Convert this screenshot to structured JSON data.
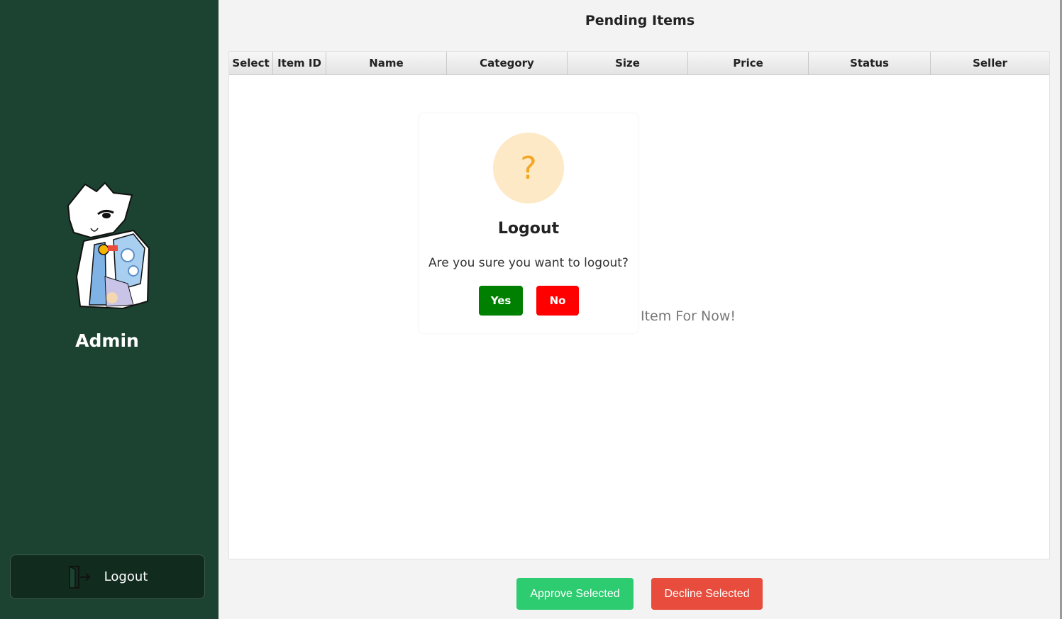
{
  "sidebar": {
    "user_name": "Admin",
    "logout_label": "Logout",
    "logout_icon": "door-exit-icon",
    "background": "#1c4331"
  },
  "main": {
    "title": "Pending Items",
    "columns": [
      "Select",
      "Item ID",
      "Name",
      "Category",
      "Size",
      "Price",
      "Status",
      "Seller"
    ],
    "empty_message_partial": "Item For Now!",
    "approve_label": "Approve Selected",
    "decline_label": "Decline Selected",
    "approve_color": "#2ecc71",
    "decline_color": "#e74c3c"
  },
  "dialog": {
    "icon": "question-icon",
    "icon_glyph": "?",
    "title": "Logout",
    "message": "Are you sure you want to logout?",
    "yes_label": "Yes",
    "no_label": "No",
    "yes_color": "#008000",
    "no_color": "#ff0000"
  }
}
